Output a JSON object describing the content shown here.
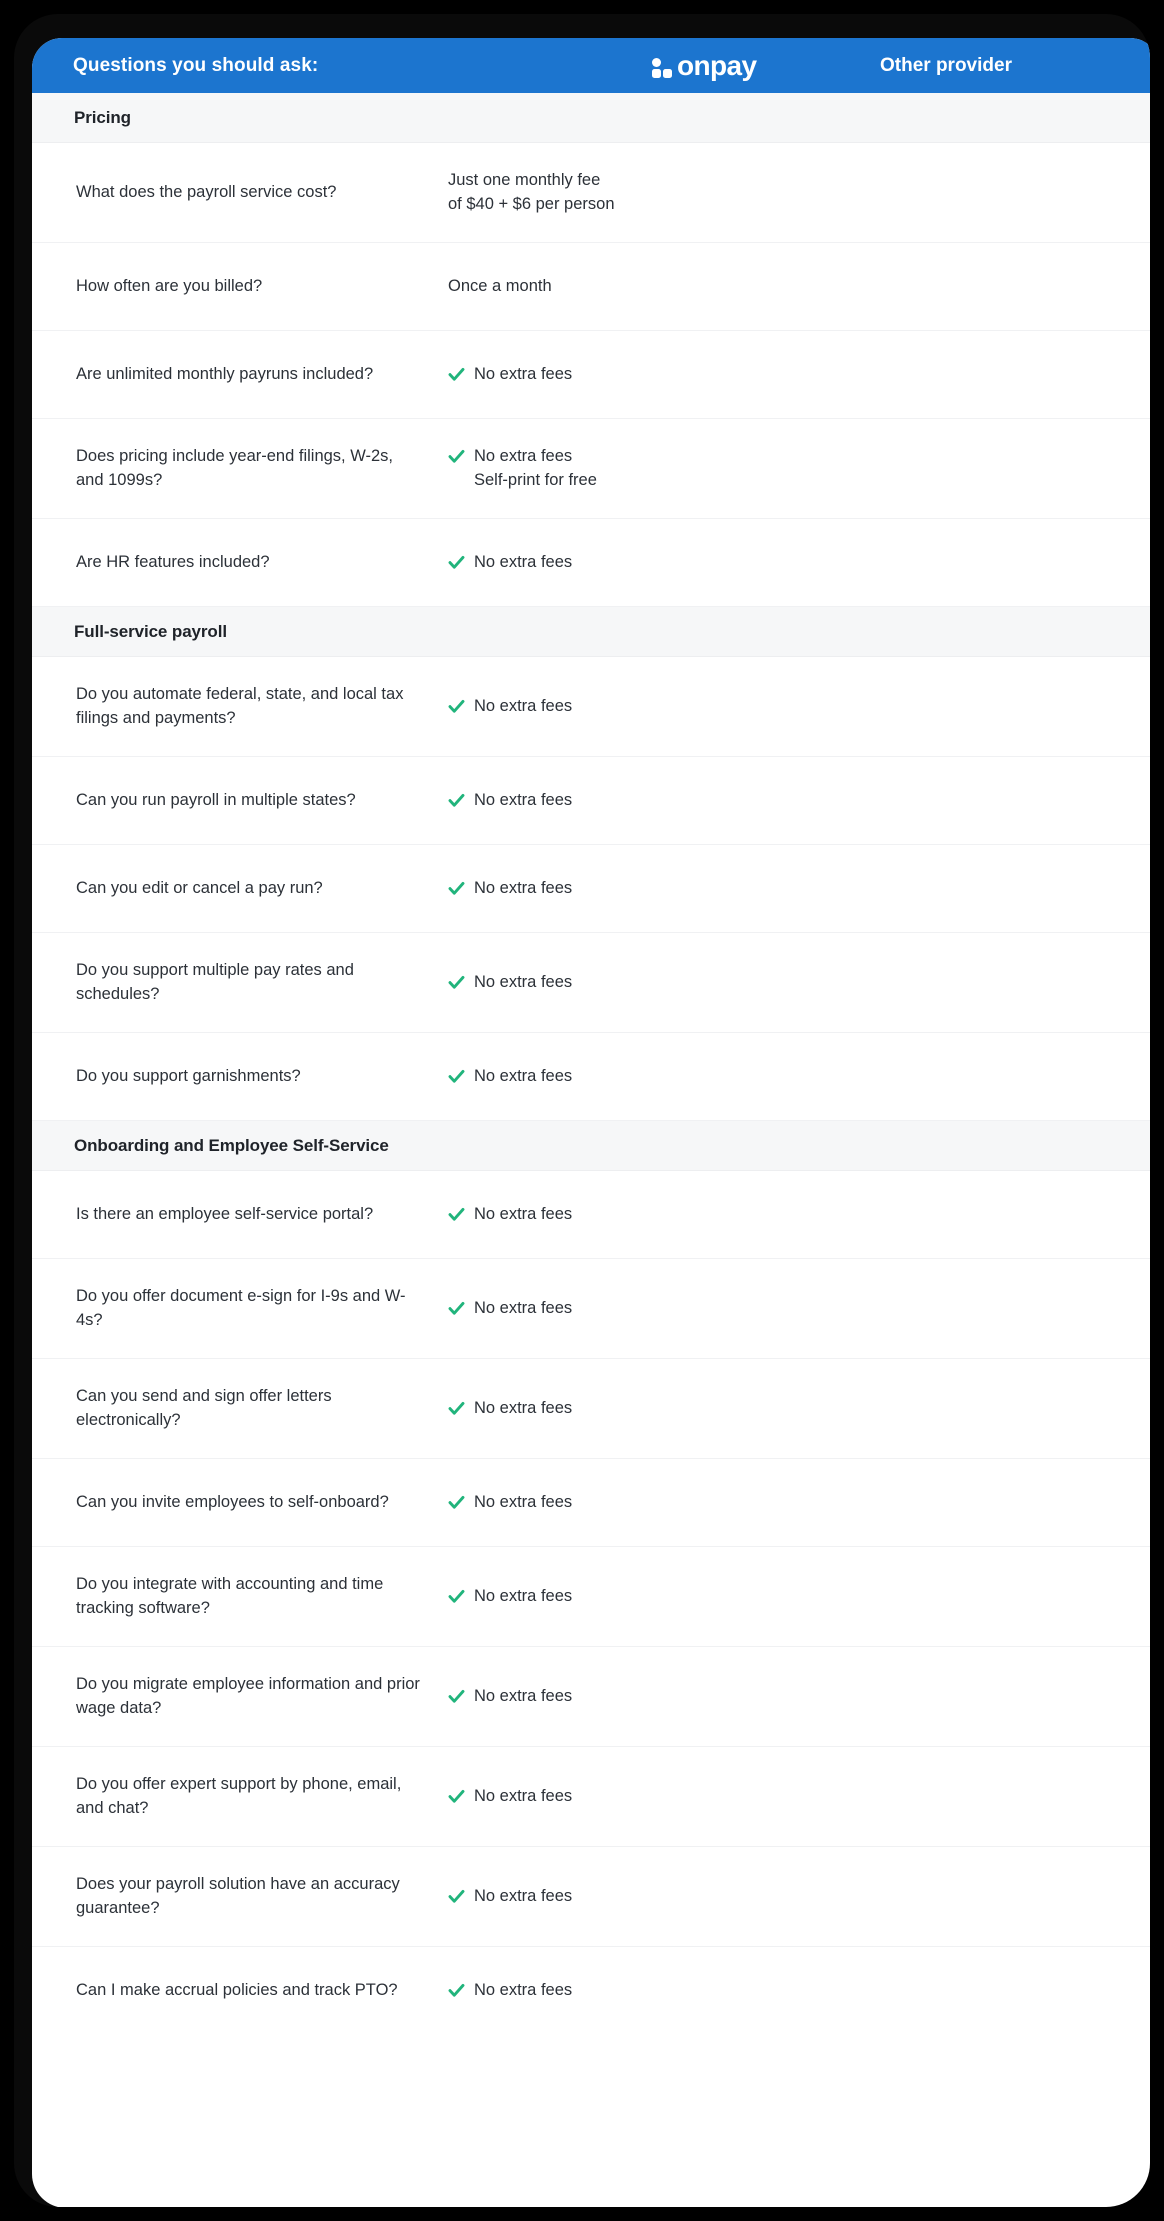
{
  "header": {
    "title": "Questions you should ask:",
    "brand_logo": "onpay-logo",
    "brand_name": "onpay",
    "other_provider": "Other provider",
    "bg_color": "#1C75CF"
  },
  "theme": {
    "accent_blue": "#1C75CF",
    "check_green": "#21B47C",
    "section_bg": "#f6f7f8",
    "text": "#2c3138"
  },
  "check_label": "No extra fees",
  "sections": [
    {
      "title": "Pricing",
      "rows": [
        {
          "question": "What does the payroll service cost?",
          "check": false,
          "value_line1": "Just one monthly fee",
          "value_line2": "of $40 + $6 per person",
          "other": ""
        },
        {
          "question": "How often are you billed?",
          "check": false,
          "value_line1": "Once a month",
          "value_line2": "",
          "other": ""
        },
        {
          "question": "Are unlimited monthly payruns included?",
          "check": true,
          "value_line1": "No extra fees",
          "value_line2": "",
          "other": ""
        },
        {
          "question": "Does pricing include year-end filings, W-2s, and 1099s?",
          "check": true,
          "value_line1": "No extra fees",
          "value_line2": "Self-print for free",
          "other": ""
        },
        {
          "question": "Are HR features included?",
          "check": true,
          "value_line1": "No extra fees",
          "value_line2": "",
          "other": ""
        }
      ]
    },
    {
      "title": "Full-service payroll",
      "rows": [
        {
          "question": "Do you automate federal, state, and local tax filings and payments?",
          "check": true,
          "value_line1": "No extra fees",
          "value_line2": "",
          "other": ""
        },
        {
          "question": "Can you run payroll in multiple states?",
          "check": true,
          "value_line1": "No extra fees",
          "value_line2": "",
          "other": ""
        },
        {
          "question": "Can you edit or cancel a pay run?",
          "check": true,
          "value_line1": "No extra fees",
          "value_line2": "",
          "other": ""
        },
        {
          "question": "Do you support multiple pay rates and schedules?",
          "check": true,
          "value_line1": "No extra fees",
          "value_line2": "",
          "other": ""
        },
        {
          "question": "Do you support garnishments?",
          "check": true,
          "value_line1": "No extra fees",
          "value_line2": "",
          "other": ""
        }
      ]
    },
    {
      "title": "Onboarding and Employee Self-Service",
      "rows": [
        {
          "question": "Is there an employee self-service portal?",
          "check": true,
          "value_line1": "No extra fees",
          "value_line2": "",
          "other": ""
        },
        {
          "question": "Do you offer document e-sign for I-9s and W-4s?",
          "check": true,
          "value_line1": "No extra fees",
          "value_line2": "",
          "other": ""
        },
        {
          "question": "Can you send and sign offer letters electronically?",
          "check": true,
          "value_line1": "No extra fees",
          "value_line2": "",
          "other": ""
        },
        {
          "question": "Can you invite employees to self-onboard?",
          "check": true,
          "value_line1": "No extra fees",
          "value_line2": "",
          "other": ""
        },
        {
          "question": "Do you integrate with accounting and time tracking software?",
          "check": true,
          "value_line1": "No extra fees",
          "value_line2": "",
          "other": ""
        },
        {
          "question": "Do you migrate employee information and prior wage data?",
          "check": true,
          "value_line1": "No extra fees",
          "value_line2": "",
          "other": ""
        },
        {
          "question": "Do you offer expert support by phone, email, and chat?",
          "check": true,
          "value_line1": "No extra fees",
          "value_line2": "",
          "other": ""
        },
        {
          "question": "Does your payroll solution have an accuracy guarantee?",
          "check": true,
          "value_line1": "No extra fees",
          "value_line2": "",
          "other": ""
        },
        {
          "question": "Can I make accrual policies and track PTO?",
          "check": true,
          "value_line1": "No extra fees",
          "value_line2": "",
          "other": ""
        }
      ]
    }
  ]
}
